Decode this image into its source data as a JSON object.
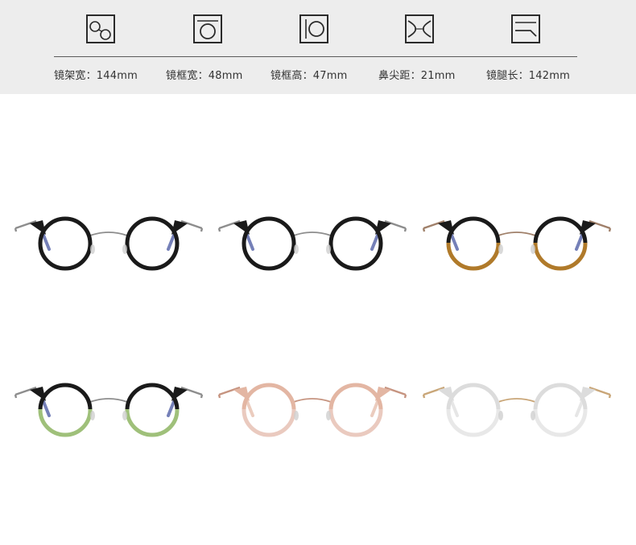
{
  "specs": [
    {
      "label": "镜架宽：144mm",
      "icon": "frame-width-icon"
    },
    {
      "label": "镜框宽：48mm",
      "icon": "lens-width-icon"
    },
    {
      "label": "镜框高：47mm",
      "icon": "lens-height-icon"
    },
    {
      "label": "鼻尖距：21mm",
      "icon": "bridge-width-icon"
    },
    {
      "label": "镜腿长：142mm",
      "icon": "temple-length-icon"
    }
  ],
  "colors": {
    "band": "#ededed",
    "black": "#1a1a1a",
    "amber": "#b07a2a",
    "green": "#9fc07a",
    "pink": "#e7bfae",
    "clear": "#e3e3e3",
    "metal": "#8d8d8d",
    "gold": "#c9a678",
    "rose_metal": "#c69480",
    "blue_tip": "#3a4a9a"
  },
  "variants": [
    {
      "name": "black",
      "top": "#1a1a1a",
      "bottom": "#1a1a1a",
      "metal": "#8d8d8d",
      "tip": "#3a4a9a"
    },
    {
      "name": "black-2",
      "top": "#1a1a1a",
      "bottom": "#1a1a1a",
      "metal": "#8d8d8d",
      "tip": "#3a4a9a"
    },
    {
      "name": "black-amber",
      "top": "#1a1a1a",
      "bottom": "#b07a2a",
      "metal": "#a0806a",
      "tip": "#3a4a9a"
    },
    {
      "name": "black-green",
      "top": "#1a1a1a",
      "bottom": "#9fc07a",
      "metal": "#8d8d8d",
      "tip": "#3a4a9a"
    },
    {
      "name": "pink",
      "top": "#e3b6a3",
      "bottom": "#eacabf",
      "metal": "#c69480",
      "tip": "#e3b6a3"
    },
    {
      "name": "clear",
      "top": "#dcdcdc",
      "bottom": "#e8e8e8",
      "metal": "#c9a678",
      "tip": "#dcdcdc"
    }
  ]
}
